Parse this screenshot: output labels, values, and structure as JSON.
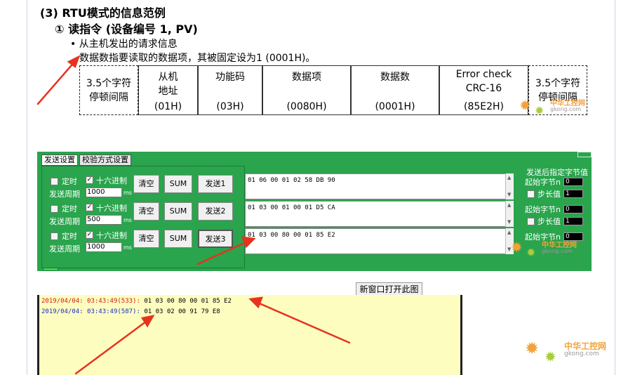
{
  "heading": "(3) RTU模式的信息范例",
  "subheading": "① 读指令 (设备编号 1, PV)",
  "bullet": "• 从主机发出的请求信息",
  "description": "数据数指要读取的数据项，其被固定设为1 (0001H)。",
  "frame": {
    "gap_left": "3.5个字符\n停顿间隔",
    "cols": [
      {
        "name": "从机\n地址",
        "hex": "(01H)"
      },
      {
        "name": "功能码",
        "hex": "(03H)"
      },
      {
        "name": "数据项",
        "hex": "(0080H)"
      },
      {
        "name": "数据数",
        "hex": "(0001H)"
      },
      {
        "name": "Error check\nCRC-16",
        "hex": "(85E2H)"
      }
    ],
    "gap_right": "3.5个字符\n停顿间隔"
  },
  "panel": {
    "tabs": [
      "发送设置",
      "校验方式设置"
    ],
    "rows": [
      {
        "timer_label": "定时",
        "hex_label": "十六进制",
        "period_label": "发送周期",
        "period": "1000",
        "unit": "ms",
        "clear": "清空",
        "sum": "SUM",
        "send": "发送1",
        "data": "01 06 00 01 02 58 DB 90"
      },
      {
        "timer_label": "定时",
        "hex_label": "十六进制",
        "period_label": "发送周期",
        "period": "500",
        "unit": "ms",
        "clear": "清空",
        "sum": "SUM",
        "send": "发送2",
        "data": "01 03 00 01 00 01 D5 CA"
      },
      {
        "timer_label": "定时",
        "hex_label": "十六进制",
        "period_label": "发送周期",
        "period": "1000",
        "unit": "ms",
        "clear": "清空",
        "sum": "SUM",
        "send": "发送3",
        "data": "01 03 00 80 00 01 85 E2"
      }
    ],
    "right": {
      "title": "发送后指定字节值",
      "start_label": "起始字节n",
      "step_label": "步长值",
      "start_value": "0",
      "step_value": "1"
    }
  },
  "open_window_button": "新窗口打开此图",
  "log": [
    {
      "time": "2019/04/04: 03:43:49(533):",
      "data": "01 03 00 80 00 01 85 E2",
      "color": "#d21a1a"
    },
    {
      "time": "2019/04/04: 03:43:49(587):",
      "data": "01 03 02 00 91 79 E8",
      "color": "#1a2fc4"
    }
  ],
  "watermark": {
    "name": "中华工控网",
    "domain": "gkong.com"
  }
}
